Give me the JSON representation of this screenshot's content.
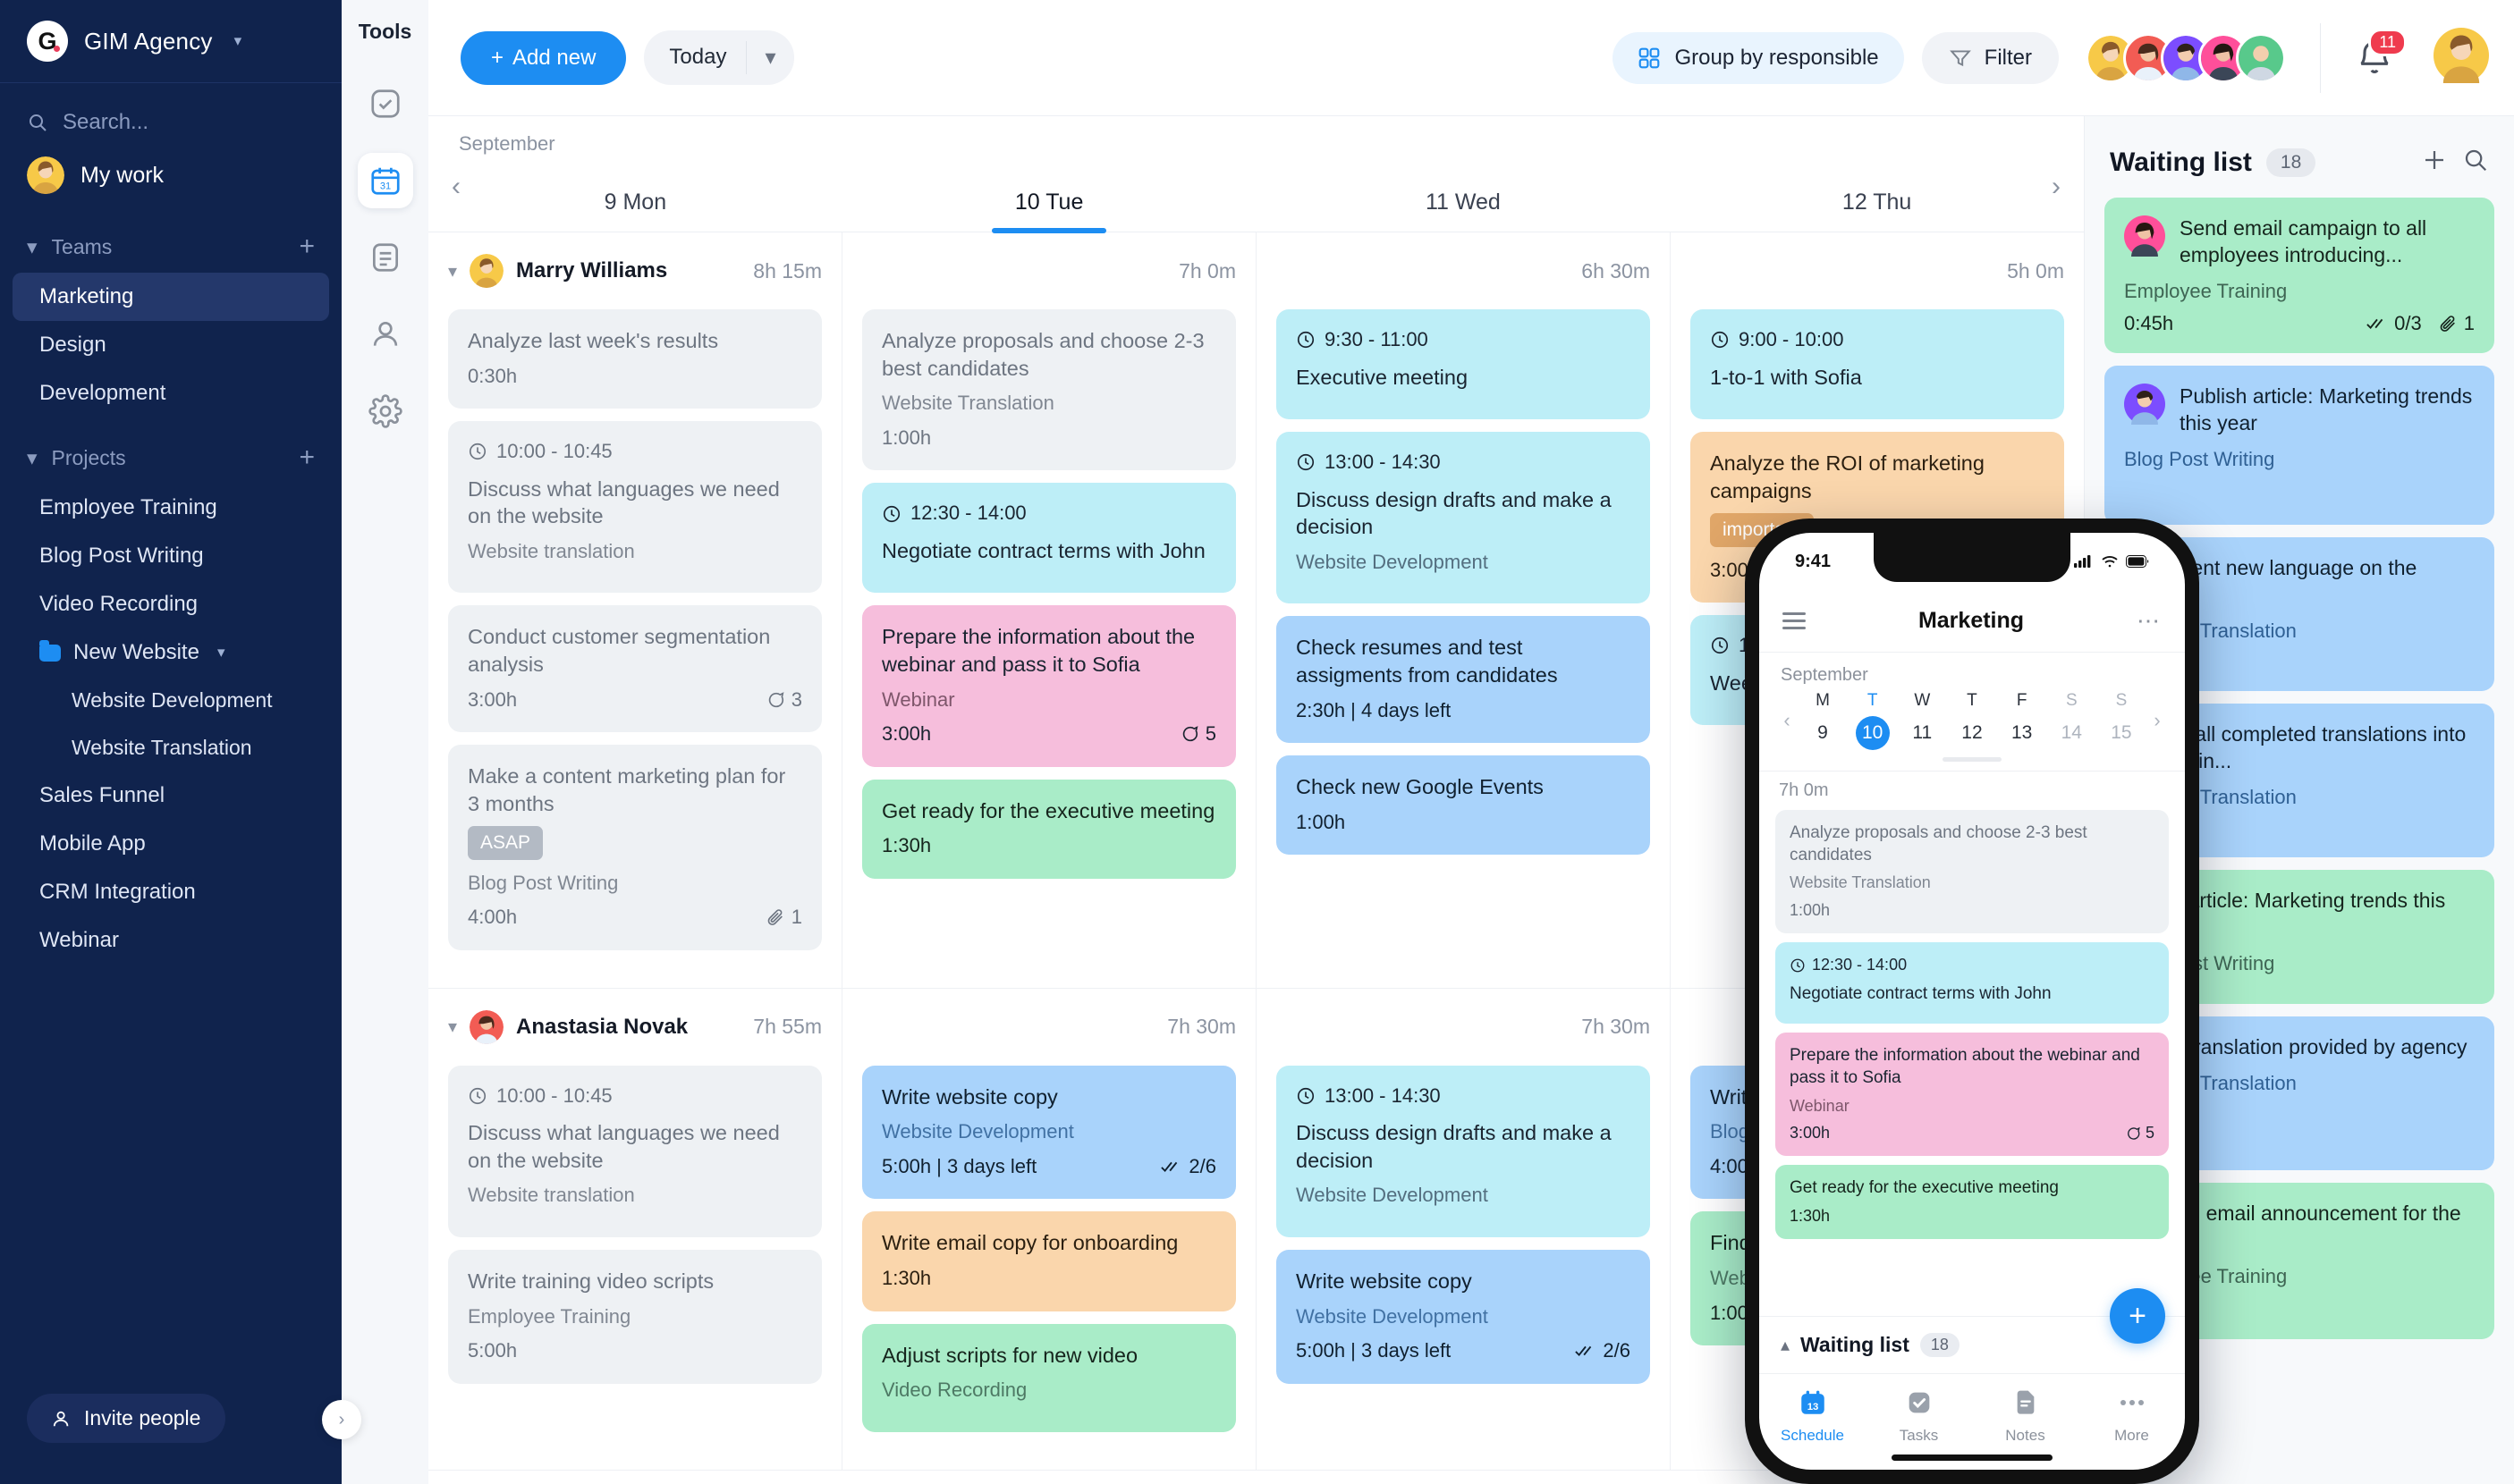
{
  "sidebar": {
    "brand": {
      "logo_letter": "G",
      "name": "GIM Agency"
    },
    "search_placeholder": "Search...",
    "my_work": "My work",
    "teams_label": "Teams",
    "teams": [
      "Marketing",
      "Design",
      "Development"
    ],
    "projects_label": "Projects",
    "projects": [
      {
        "label": "Employee Training"
      },
      {
        "label": "Blog Post Writing"
      },
      {
        "label": "Video Recording"
      },
      {
        "label": "New Website",
        "folder": true
      },
      {
        "label": "Website Development",
        "sub": true
      },
      {
        "label": "Website Translation",
        "sub": true
      },
      {
        "label": "Sales Funnel"
      },
      {
        "label": "Mobile App"
      },
      {
        "label": "CRM Integration"
      },
      {
        "label": "Webinar"
      }
    ],
    "invite": "Invite people"
  },
  "rail": {
    "title": "Tools",
    "items": [
      {
        "icon": "check-square-icon",
        "active": false
      },
      {
        "icon": "calendar-31-icon",
        "active": true
      },
      {
        "icon": "notes-icon",
        "active": false
      },
      {
        "icon": "person-icon",
        "active": false
      },
      {
        "icon": "gear-icon",
        "active": false
      }
    ]
  },
  "topbar": {
    "add_new": "Add new",
    "today": "Today",
    "group_by": "Group by responsible",
    "filter": "Filter",
    "notification_count": "11"
  },
  "calendar": {
    "month": "September",
    "days": [
      {
        "label": "9 Mon",
        "active": false
      },
      {
        "label": "10 Tue",
        "active": true
      },
      {
        "label": "11 Wed",
        "active": false
      },
      {
        "label": "12 Thu",
        "active": false
      }
    ]
  },
  "rows": [
    {
      "user": {
        "name": "Marry Williams",
        "total": "8h 15m",
        "avatar": "#f7c948"
      },
      "totals": [
        "7h 0m",
        "6h 30m",
        "5h 0m"
      ],
      "columns": [
        [
          {
            "color": "grey",
            "title": "Analyze last week's results",
            "duration": "0:30h"
          },
          {
            "color": "grey",
            "time": "10:00 - 10:45",
            "title": "Discuss what languages we need on the website",
            "project": "Website translation"
          },
          {
            "color": "grey",
            "title": "Conduct customer segmentation analysis",
            "duration": "3:00h",
            "comments": "3"
          },
          {
            "color": "grey",
            "title": "Make a content marketing plan for 3 months",
            "tag": "ASAP",
            "tag_color": "grey",
            "project": "Blog Post Writing",
            "duration": "4:00h",
            "attachments": "1"
          }
        ],
        [
          {
            "color": "grey",
            "title": "Analyze proposals and choose 2-3 best candidates",
            "project": "Website Translation",
            "duration": "1:00h"
          },
          {
            "color": "cyan",
            "time": "12:30 - 14:00",
            "title": "Negotiate contract terms with John"
          },
          {
            "color": "pink",
            "title": "Prepare the information about the webinar and pass it to Sofia",
            "project": "Webinar",
            "duration": "3:00h",
            "comments": "5"
          },
          {
            "color": "green",
            "title": "Get ready for the executive meeting",
            "duration": "1:30h"
          }
        ],
        [
          {
            "color": "cyan",
            "time": "9:30 - 11:00",
            "title": "Executive meeting"
          },
          {
            "color": "cyan",
            "time": "13:00 - 14:30",
            "title": "Discuss design drafts and make a decision",
            "project": "Website Development"
          },
          {
            "color": "blue",
            "title": "Check resumes and test assigments from candidates",
            "duration": "2:30h | 4 days left"
          },
          {
            "color": "blue",
            "title": "Check new Google Events",
            "duration": "1:00h"
          }
        ],
        [
          {
            "color": "cyan",
            "time": "9:00 - 10:00",
            "title": "1-to-1 with Sofia"
          },
          {
            "color": "orange",
            "title": "Analyze the ROI of marketing campaigns",
            "tag": "important",
            "tag_color": "orange",
            "duration": "3:00h"
          },
          {
            "color": "cyan",
            "time": "16:",
            "title": "Week"
          }
        ]
      ]
    },
    {
      "user": {
        "name": "Anastasia Novak",
        "total": "7h 55m",
        "avatar": "#f25c54"
      },
      "totals": [
        "7h 30m",
        "7h 30m",
        ""
      ],
      "columns": [
        [
          {
            "color": "grey",
            "time": "10:00 - 10:45",
            "title": "Discuss what languages we need on the website",
            "project": "Website translation"
          },
          {
            "color": "grey",
            "title": "Write training video scripts",
            "project": "Employee Training",
            "duration": "5:00h"
          }
        ],
        [
          {
            "color": "blue",
            "title": "Write website copy",
            "project": "Website Development",
            "duration": "5:00h | 3 days left",
            "checks": "2/6"
          },
          {
            "color": "orange",
            "title": "Write email copy for onboarding",
            "duration": "1:30h"
          },
          {
            "color": "green",
            "title": "Adjust scripts for new video",
            "project": "Video Recording"
          }
        ],
        [
          {
            "color": "cyan",
            "time": "13:00 - 14:30",
            "title": "Discuss design drafts and make a decision",
            "project": "Website Development"
          },
          {
            "color": "blue",
            "title": "Write website copy",
            "project": "Website Development",
            "duration": "5:00h | 3 days left",
            "checks": "2/6"
          }
        ],
        [
          {
            "color": "blue",
            "title": "Write",
            "project": "Blog P",
            "duration": "4:00h"
          },
          {
            "color": "green",
            "title": "Find a and ra",
            "project": "Websi",
            "duration": "1:00h"
          }
        ]
      ]
    }
  ],
  "waiting_list": {
    "title": "Waiting list",
    "count": "18",
    "items": [
      {
        "color": "green",
        "title": "Send email campaign to all employees introducing...",
        "project": "Employee Training",
        "duration": "0:45h",
        "checks": "0/3",
        "attachments": "1",
        "avatar": "#ff4f9a"
      },
      {
        "color": "blue",
        "title": "Publish article: Marketing trends this year",
        "project": "Blog Post Writing",
        "duration": "",
        "avatar": "#7c4dff"
      },
      {
        "color": "blue",
        "title": "Implement new language on the website",
        "project": "Website Translation"
      },
      {
        "color": "blue",
        "title": "Upload all completed translations into the admin...",
        "project": "Website Translation"
      },
      {
        "color": "green",
        "title": "Check article: Marketing trends this year",
        "project": "Blog Post Writing"
      },
      {
        "color": "blue",
        "title": "Check translation provided by agency",
        "project": "Website Translation"
      },
      {
        "color": "green",
        "title": "Write an email announcement for the ne...",
        "project": "Employee Training"
      }
    ]
  },
  "phone": {
    "status_time": "9:41",
    "nav_title": "Marketing",
    "month": "September",
    "week": [
      {
        "d": "M",
        "n": "9",
        "state": ""
      },
      {
        "d": "T",
        "n": "10",
        "state": "sel"
      },
      {
        "d": "W",
        "n": "11",
        "state": ""
      },
      {
        "d": "T",
        "n": "12",
        "state": ""
      },
      {
        "d": "F",
        "n": "13",
        "state": ""
      },
      {
        "d": "S",
        "n": "14",
        "state": "dim"
      },
      {
        "d": "S",
        "n": "15",
        "state": "dim"
      }
    ],
    "total": "7h 0m",
    "cards": [
      {
        "color": "grey",
        "title": "Analyze proposals and choose 2-3 best candidates",
        "project": "Website Translation",
        "duration": "1:00h"
      },
      {
        "color": "cyan",
        "time": "12:30 - 14:00",
        "title": "Negotiate contract terms with John"
      },
      {
        "color": "pink",
        "title": "Prepare the information about the webinar and pass it to Sofia",
        "project": "Webinar",
        "duration": "3:00h",
        "comments": "5"
      },
      {
        "color": "green",
        "title": "Get ready for the executive meeting",
        "duration": "1:30h"
      }
    ],
    "waiting_title": "Waiting list",
    "waiting_count": "18",
    "tabs": [
      {
        "label": "Schedule",
        "icon": "calendar-13-icon",
        "active": true
      },
      {
        "label": "Tasks",
        "icon": "check-square-icon",
        "active": false
      },
      {
        "label": "Notes",
        "icon": "notes-icon",
        "active": false
      },
      {
        "label": "More",
        "icon": "ellipsis-icon",
        "active": false
      }
    ]
  },
  "colors": {
    "accent": "#1d8df2",
    "sidebar_bg": "#10234d",
    "badge_red": "#ef3b4e"
  }
}
